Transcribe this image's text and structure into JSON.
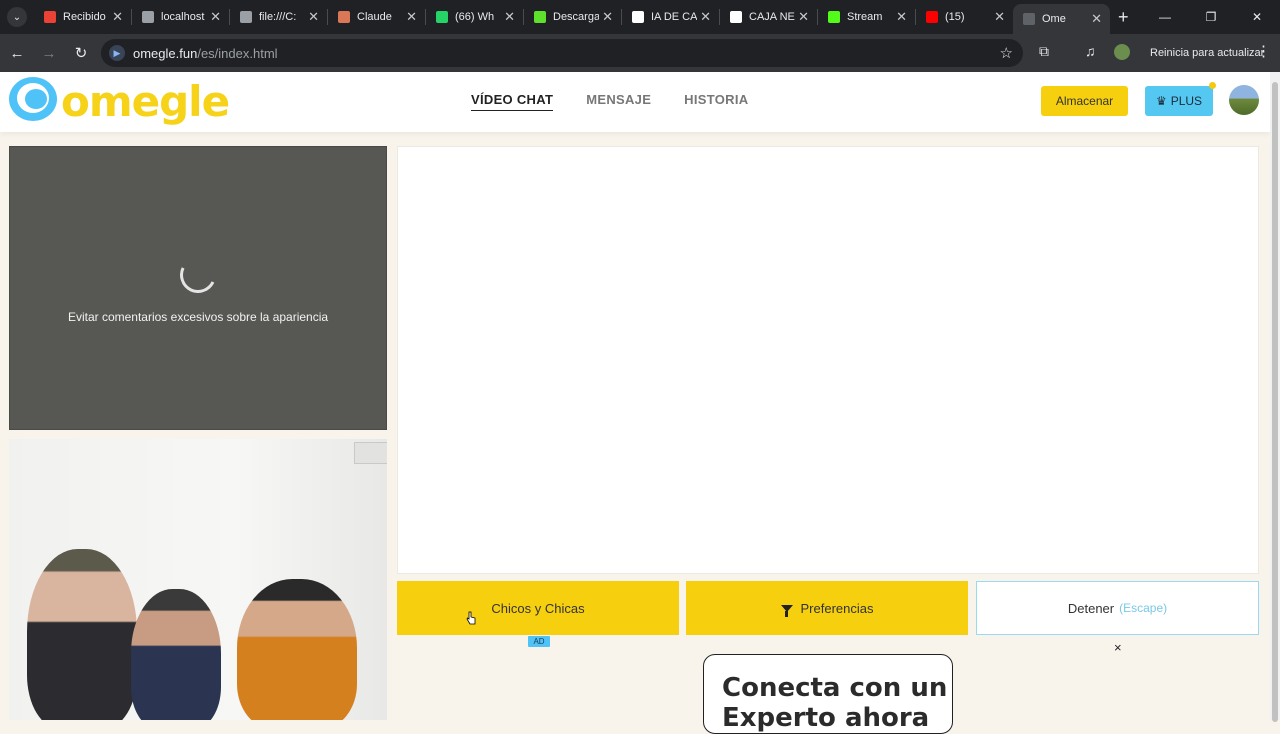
{
  "browser": {
    "tabs": [
      {
        "title": "Recibido",
        "color": "#ea4335"
      },
      {
        "title": "localhost",
        "color": "#9aa0a6"
      },
      {
        "title": "file:///C:",
        "color": "#9aa0a6"
      },
      {
        "title": "Claude",
        "color": "#d97757"
      },
      {
        "title": "(66) Wh",
        "color": "#25d366"
      },
      {
        "title": "Descarga",
        "color": "#5ee12b"
      },
      {
        "title": "IA DE CA",
        "color": "#ffffff"
      },
      {
        "title": "CAJA NE",
        "color": "#ffffff"
      },
      {
        "title": "Stream",
        "color": "#53fc18"
      },
      {
        "title": "(15)",
        "color": "#ff0000"
      },
      {
        "title": "Ome",
        "color": "#5f6368"
      }
    ],
    "url_host": "omegle.fun",
    "url_path": "/es/index.html",
    "update_label": "Reinicia para actualizar"
  },
  "header": {
    "logo_text": "omegle",
    "nav": [
      {
        "label": "VÍDEO CHAT",
        "active": true
      },
      {
        "label": "MENSAJE",
        "active": false
      },
      {
        "label": "HISTORIA",
        "active": false
      }
    ],
    "store_label": "Almacenar",
    "plus_label": "PLUS"
  },
  "video": {
    "remote_message": "Evitar comentarios excesivos sobre la apariencia"
  },
  "controls": {
    "gender_label": "Chicos y Chicas",
    "preferences_label": "Preferencias",
    "stop_label": "Detener",
    "stop_hint": "(Escape)"
  },
  "ad": {
    "badge": "AD",
    "close": "×",
    "headline": "Conecta con un",
    "headline2": "Experto ahora"
  },
  "colors": {
    "brand_yellow": "#f6d00f",
    "brand_blue": "#4fc3f7"
  }
}
